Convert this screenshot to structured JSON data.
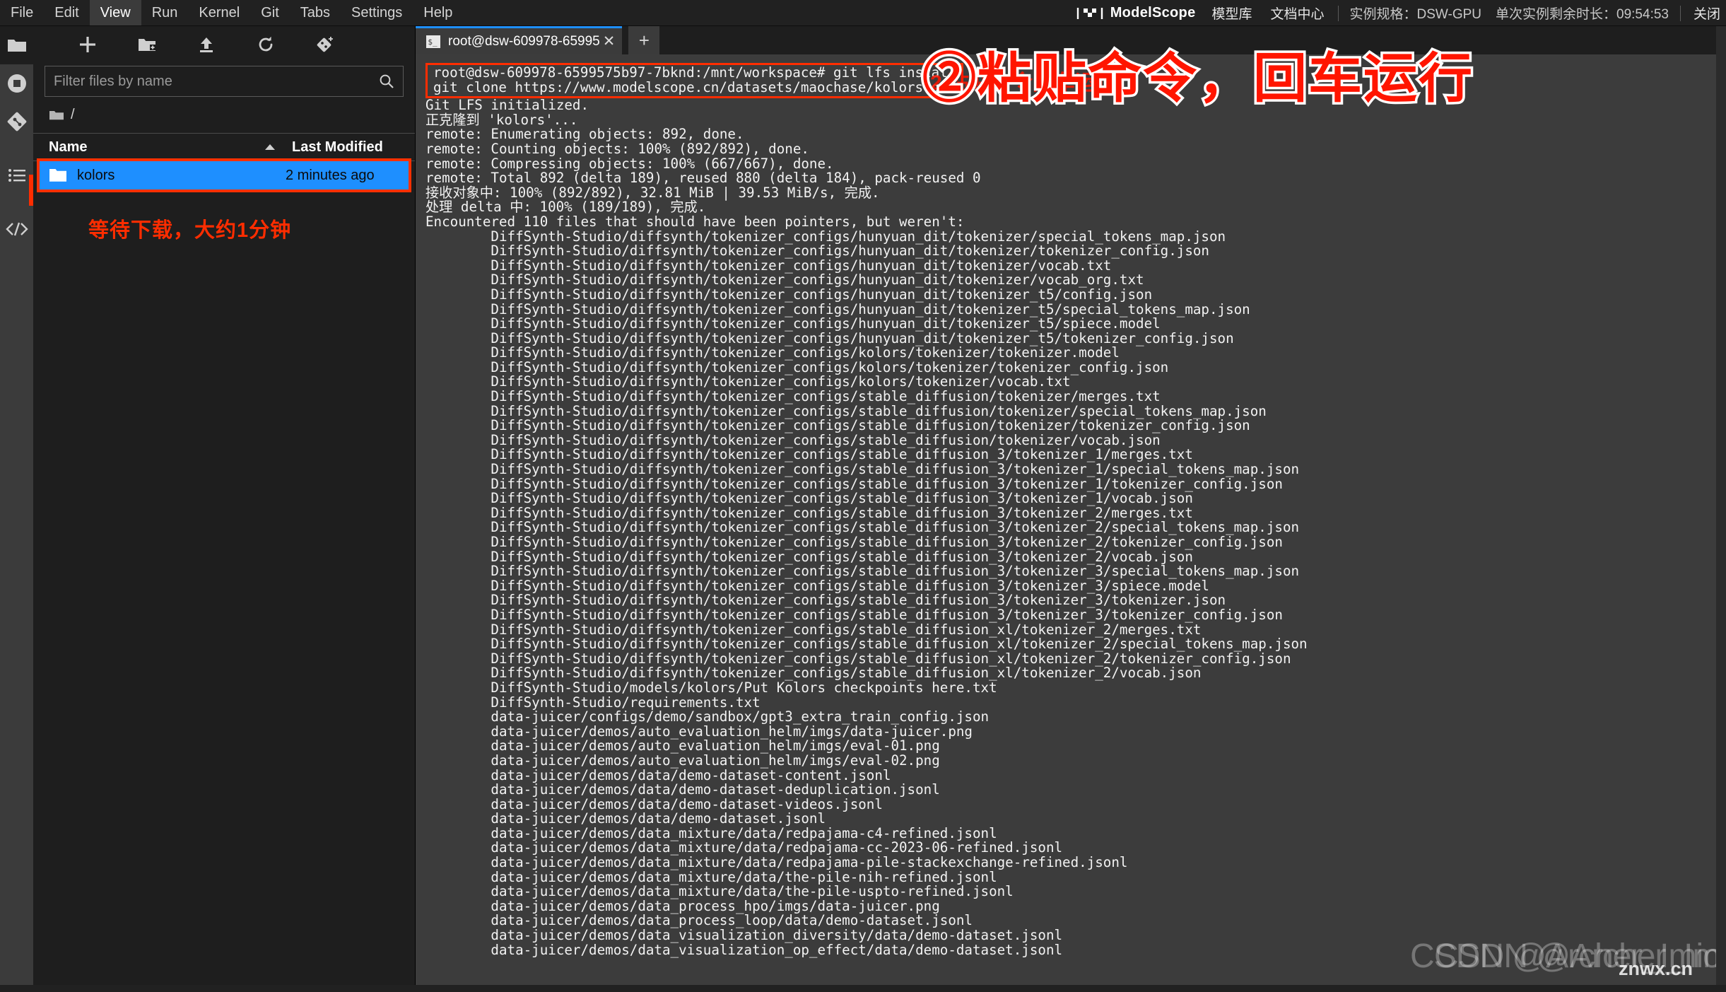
{
  "menubar": {
    "items": [
      {
        "label": "File",
        "active": false
      },
      {
        "label": "Edit",
        "active": false
      },
      {
        "label": "View",
        "active": true
      },
      {
        "label": "Run",
        "active": false
      },
      {
        "label": "Kernel",
        "active": false
      },
      {
        "label": "Git",
        "active": false
      },
      {
        "label": "Tabs",
        "active": false
      },
      {
        "label": "Settings",
        "active": false
      },
      {
        "label": "Help",
        "active": false
      }
    ]
  },
  "topright": {
    "brand": "ModelScope",
    "links": [
      "模型库",
      "文档中心"
    ],
    "instance_spec": "实例规格：DSW-GPU",
    "remaining_time": "单次实例剩余时长：09:54:53",
    "close_label": "关闭"
  },
  "activitybar": {
    "icons": [
      {
        "name": "file-browser-icon",
        "active": true
      },
      {
        "name": "running-terminals-icon",
        "active": false
      },
      {
        "name": "git-icon",
        "active": false
      },
      {
        "name": "table-of-contents-icon",
        "active": false
      },
      {
        "name": "extension-manager-icon",
        "active": false
      }
    ]
  },
  "filebrowser": {
    "toolbar": [
      "new-launcher-icon",
      "new-folder-icon",
      "upload-icon",
      "refresh-icon",
      "new-checkpoint-icon"
    ],
    "filter_placeholder": "Filter files by name",
    "filter_value": "",
    "breadcrumb": "/",
    "columns": {
      "name": "Name",
      "modified": "Last Modified"
    },
    "sort_direction": "ascending",
    "rows": [
      {
        "name": "kolors",
        "modified": "2 minutes ago",
        "selected": true,
        "type": "folder"
      }
    ],
    "note": "等待下载，大约1分钟"
  },
  "terminal": {
    "tab_label": "root@dsw-609978-65995",
    "tab_close": "✕",
    "new_tab": "+",
    "command_lines": [
      "root@dsw-609978-6599575b97-7bknd:/mnt/workspace# git lfs install",
      "git clone https://www.modelscope.cn/datasets/maochase/kolors.git"
    ],
    "output_lines": [
      "Git LFS initialized.",
      "正克隆到 'kolors'...",
      "remote: Enumerating objects: 892, done.",
      "remote: Counting objects: 100% (892/892), done.",
      "remote: Compressing objects: 100% (667/667), done.",
      "remote: Total 892 (delta 189), reused 880 (delta 184), pack-reused 0",
      "接收对象中: 100% (892/892), 32.81 MiB | 39.53 MiB/s, 完成.",
      "处理 delta 中: 100% (189/189), 完成.",
      "Encountered 110 files that should have been pointers, but weren't:",
      "        DiffSynth-Studio/diffsynth/tokenizer_configs/hunyuan_dit/tokenizer/special_tokens_map.json",
      "        DiffSynth-Studio/diffsynth/tokenizer_configs/hunyuan_dit/tokenizer/tokenizer_config.json",
      "        DiffSynth-Studio/diffsynth/tokenizer_configs/hunyuan_dit/tokenizer/vocab.txt",
      "        DiffSynth-Studio/diffsynth/tokenizer_configs/hunyuan_dit/tokenizer/vocab_org.txt",
      "        DiffSynth-Studio/diffsynth/tokenizer_configs/hunyuan_dit/tokenizer_t5/config.json",
      "        DiffSynth-Studio/diffsynth/tokenizer_configs/hunyuan_dit/tokenizer_t5/special_tokens_map.json",
      "        DiffSynth-Studio/diffsynth/tokenizer_configs/hunyuan_dit/tokenizer_t5/spiece.model",
      "        DiffSynth-Studio/diffsynth/tokenizer_configs/hunyuan_dit/tokenizer_t5/tokenizer_config.json",
      "        DiffSynth-Studio/diffsynth/tokenizer_configs/kolors/tokenizer/tokenizer.model",
      "        DiffSynth-Studio/diffsynth/tokenizer_configs/kolors/tokenizer/tokenizer_config.json",
      "        DiffSynth-Studio/diffsynth/tokenizer_configs/kolors/tokenizer/vocab.txt",
      "        DiffSynth-Studio/diffsynth/tokenizer_configs/stable_diffusion/tokenizer/merges.txt",
      "        DiffSynth-Studio/diffsynth/tokenizer_configs/stable_diffusion/tokenizer/special_tokens_map.json",
      "        DiffSynth-Studio/diffsynth/tokenizer_configs/stable_diffusion/tokenizer/tokenizer_config.json",
      "        DiffSynth-Studio/diffsynth/tokenizer_configs/stable_diffusion/tokenizer/vocab.json",
      "        DiffSynth-Studio/diffsynth/tokenizer_configs/stable_diffusion_3/tokenizer_1/merges.txt",
      "        DiffSynth-Studio/diffsynth/tokenizer_configs/stable_diffusion_3/tokenizer_1/special_tokens_map.json",
      "        DiffSynth-Studio/diffsynth/tokenizer_configs/stable_diffusion_3/tokenizer_1/tokenizer_config.json",
      "        DiffSynth-Studio/diffsynth/tokenizer_configs/stable_diffusion_3/tokenizer_1/vocab.json",
      "        DiffSynth-Studio/diffsynth/tokenizer_configs/stable_diffusion_3/tokenizer_2/merges.txt",
      "        DiffSynth-Studio/diffsynth/tokenizer_configs/stable_diffusion_3/tokenizer_2/special_tokens_map.json",
      "        DiffSynth-Studio/diffsynth/tokenizer_configs/stable_diffusion_3/tokenizer_2/tokenizer_config.json",
      "        DiffSynth-Studio/diffsynth/tokenizer_configs/stable_diffusion_3/tokenizer_2/vocab.json",
      "        DiffSynth-Studio/diffsynth/tokenizer_configs/stable_diffusion_3/tokenizer_3/special_tokens_map.json",
      "        DiffSynth-Studio/diffsynth/tokenizer_configs/stable_diffusion_3/tokenizer_3/spiece.model",
      "        DiffSynth-Studio/diffsynth/tokenizer_configs/stable_diffusion_3/tokenizer_3/tokenizer.json",
      "        DiffSynth-Studio/diffsynth/tokenizer_configs/stable_diffusion_3/tokenizer_3/tokenizer_config.json",
      "        DiffSynth-Studio/diffsynth/tokenizer_configs/stable_diffusion_xl/tokenizer_2/merges.txt",
      "        DiffSynth-Studio/diffsynth/tokenizer_configs/stable_diffusion_xl/tokenizer_2/special_tokens_map.json",
      "        DiffSynth-Studio/diffsynth/tokenizer_configs/stable_diffusion_xl/tokenizer_2/tokenizer_config.json",
      "        DiffSynth-Studio/diffsynth/tokenizer_configs/stable_diffusion_xl/tokenizer_2/vocab.json",
      "        DiffSynth-Studio/models/kolors/Put Kolors checkpoints here.txt",
      "        DiffSynth-Studio/requirements.txt",
      "        data-juicer/configs/demo/sandbox/gpt3_extra_train_config.json",
      "        data-juicer/demos/auto_evaluation_helm/imgs/data-juicer.png",
      "        data-juicer/demos/auto_evaluation_helm/imgs/eval-01.png",
      "        data-juicer/demos/auto_evaluation_helm/imgs/eval-02.png",
      "        data-juicer/demos/data/demo-dataset-content.jsonl",
      "        data-juicer/demos/data/demo-dataset-deduplication.jsonl",
      "        data-juicer/demos/data/demo-dataset-videos.jsonl",
      "        data-juicer/demos/data/demo-dataset.jsonl",
      "        data-juicer/demos/data_mixture/data/redpajama-c4-refined.jsonl",
      "        data-juicer/demos/data_mixture/data/redpajama-cc-2023-06-refined.jsonl",
      "        data-juicer/demos/data_mixture/data/redpajama-pile-stackexchange-refined.jsonl",
      "        data-juicer/demos/data_mixture/data/the-pile-nih-refined.jsonl",
      "        data-juicer/demos/data_mixture/data/the-pile-uspto-refined.jsonl",
      "        data-juicer/demos/data_process_hpo/imgs/data-juicer.png",
      "        data-juicer/demos/data_process_loop/data/demo-dataset.jsonl",
      "        data-juicer/demos/data_visualization_diversity/data/demo-dataset.jsonl",
      "        data-juicer/demos/data_visualization_op_effect/data/demo-dataset.jsonl"
    ]
  },
  "annotation": {
    "step_text": "②粘贴命令，回车运行",
    "ghost_text": "2.粘贴命令回车运行",
    "color": "#ff1500"
  },
  "watermark": {
    "csdn_a": "CSDN @Archer_Imio",
    "csdn_b": "CSDN @Archer_Imio",
    "site": "znwx.cn"
  },
  "colors": {
    "accent_blue": "#1e8fff",
    "annotation_red": "#ff2d00",
    "terminal_bg": "#3c3c3c",
    "panel_bg": "#1e1e1e"
  }
}
